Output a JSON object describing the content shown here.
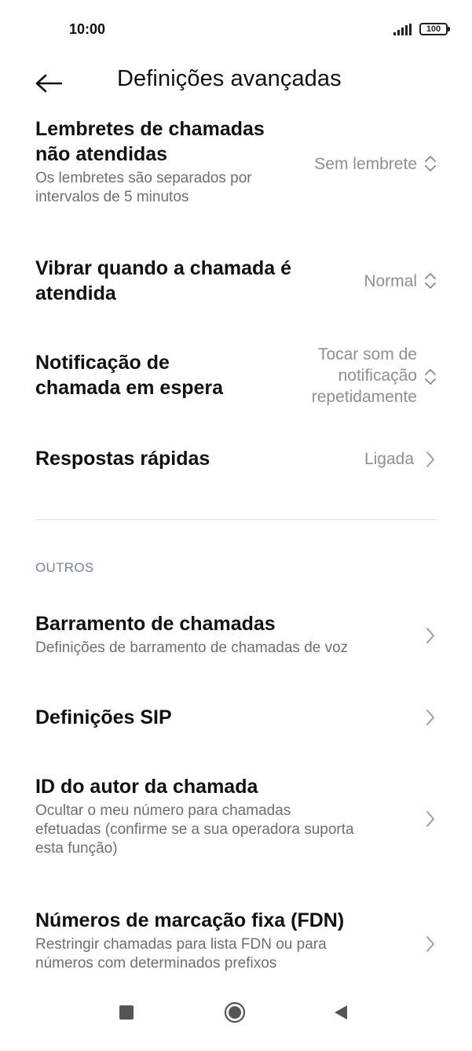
{
  "status_bar": {
    "time": "10:00",
    "battery": "100"
  },
  "header": {
    "title": "Definições avançadas"
  },
  "settings": [
    {
      "title_line1": "Lembretes de chamadas",
      "title_line2": "não atendidas",
      "subtitle_line1": "Os lembretes são separados por",
      "subtitle_line2": "intervalos de 5 minutos",
      "value": "Sem lembrete"
    },
    {
      "title_line1": "Vibrar quando a chamada é",
      "title_line2": "atendida",
      "value": "Normal"
    },
    {
      "title_line1": "Notificação de",
      "title_line2": "chamada em espera",
      "value_line1": "Tocar som de",
      "value_line2": "notificação",
      "value_line3": "repetidamente"
    },
    {
      "title": "Respostas rápidas",
      "value": "Ligada"
    }
  ],
  "others": {
    "header": "OUTROS",
    "items": [
      {
        "title": "Barramento de chamadas",
        "subtitle": "Definições de barramento de chamadas de voz"
      },
      {
        "title": "Definições SIP"
      },
      {
        "title": "ID do autor da chamada",
        "subtitle_line1": "Ocultar o meu número para chamadas",
        "subtitle_line2": "efetuadas (confirme se a sua operadora suporta",
        "subtitle_line3": "esta função)"
      },
      {
        "title": "Números de marcação fixa (FDN)",
        "subtitle_line1": "Restringir chamadas para lista FDN ou para",
        "subtitle_line2": "números com determinados prefixos"
      }
    ]
  },
  "icons": {
    "back": "back-arrow-icon",
    "updown": "up-down-chevron-icon",
    "chevron": "chevron-right-icon",
    "nav": [
      "square-recents-icon",
      "circle-home-icon",
      "triangle-back-icon"
    ]
  },
  "colors": {
    "title": "#111111",
    "value": "#8f8f8f",
    "subtitle": "#6f6f6f",
    "section": "#7a82a6"
  }
}
